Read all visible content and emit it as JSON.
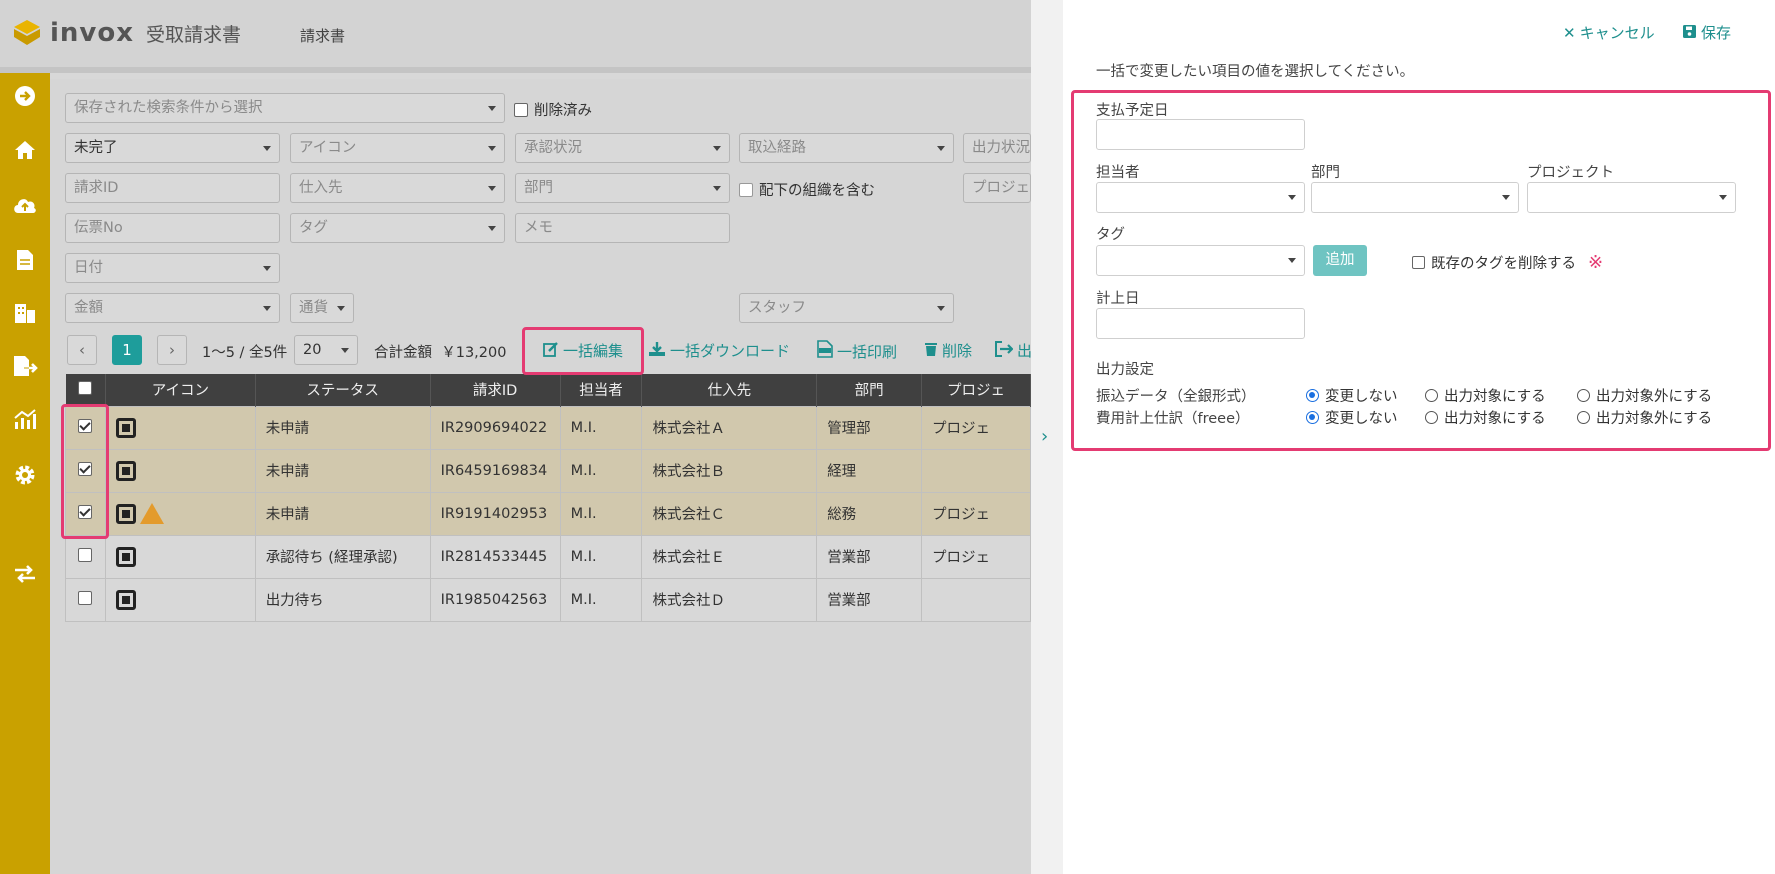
{
  "app": {
    "logo": "invox",
    "logo_sub": "受取請求書",
    "nav": "請求書"
  },
  "colors": {
    "brand": "#c9a100",
    "accent": "#1e9d9b",
    "highlight": "#e43b72"
  },
  "sidebar": {
    "icons": [
      "login-icon",
      "home-icon",
      "upload-cloud-icon",
      "document-icon",
      "building-icon",
      "export-icon",
      "chart-icon",
      "gear-icon",
      "switch-icon"
    ]
  },
  "filters": {
    "saved": "保存された検索条件から選択",
    "deleted": "削除済み",
    "status": "未完了",
    "icon": "アイコン",
    "approval": "承認状況",
    "intake": "取込経路",
    "output": "出力状況",
    "invoice_id": "請求ID",
    "supplier": "仕入先",
    "dept": "部門",
    "include_sub": "配下の組織を含む",
    "project": "プロジェ",
    "voucher": "伝票No",
    "tag": "タグ",
    "memo": "メモ",
    "date": "日付",
    "amount": "金額",
    "currency": "通貨",
    "staff": "スタッフ"
  },
  "toolbar": {
    "prev": "‹",
    "page": "1",
    "next": "›",
    "range": "1〜5 / 全5件",
    "per_page": "20",
    "total_label": "合計金額",
    "total_value": "￥13,200",
    "bulk_edit": "一括編集",
    "bulk_download": "一括ダウンロード",
    "bulk_print": "一括印刷",
    "delete": "削除",
    "output": "出"
  },
  "table": {
    "headers": [
      "アイコン",
      "ステータス",
      "請求ID",
      "担当者",
      "仕入先",
      "部門",
      "プロジェ"
    ],
    "rows": [
      {
        "checked": true,
        "warn": false,
        "status": "未申請",
        "id": "IR2909694022",
        "owner": "M.I.",
        "supplier": "株式会社Ａ",
        "dept": "管理部",
        "project": "プロジェ"
      },
      {
        "checked": true,
        "warn": false,
        "status": "未申請",
        "id": "IR6459169834",
        "owner": "M.I.",
        "supplier": "株式会社Ｂ",
        "dept": "経理",
        "project": ""
      },
      {
        "checked": true,
        "warn": true,
        "status": "未申請",
        "id": "IR9191402953",
        "owner": "M.I.",
        "supplier": "株式会社Ｃ",
        "dept": "総務",
        "project": "プロジェ"
      },
      {
        "checked": false,
        "warn": false,
        "status": "承認待ち (経理承認)",
        "id": "IR2814533445",
        "owner": "M.I.",
        "supplier": "株式会社Ｅ",
        "dept": "営業部",
        "project": "プロジェ"
      },
      {
        "checked": false,
        "warn": false,
        "status": "出力待ち",
        "id": "IR1985042563",
        "owner": "M.I.",
        "supplier": "株式会社Ｄ",
        "dept": "営業部",
        "project": ""
      }
    ]
  },
  "panel": {
    "cancel": "キャンセル",
    "save": "保存",
    "instruction": "一括で変更したい項目の値を選択してください。",
    "pay_date": "支払予定日",
    "owner": "担当者",
    "dept": "部門",
    "project": "プロジェクト",
    "tag": "タグ",
    "add": "追加",
    "remove_tags": "既存のタグを削除する",
    "post_date": "計上日",
    "output_settings": "出力設定",
    "output_rows": [
      {
        "label": "振込データ（全銀形式）",
        "options": [
          "変更しない",
          "出力対象にする",
          "出力対象外にする"
        ],
        "selected": 0
      },
      {
        "label": "費用計上仕訳（freee）",
        "options": [
          "変更しない",
          "出力対象にする",
          "出力対象外にする"
        ],
        "selected": 0
      }
    ]
  }
}
